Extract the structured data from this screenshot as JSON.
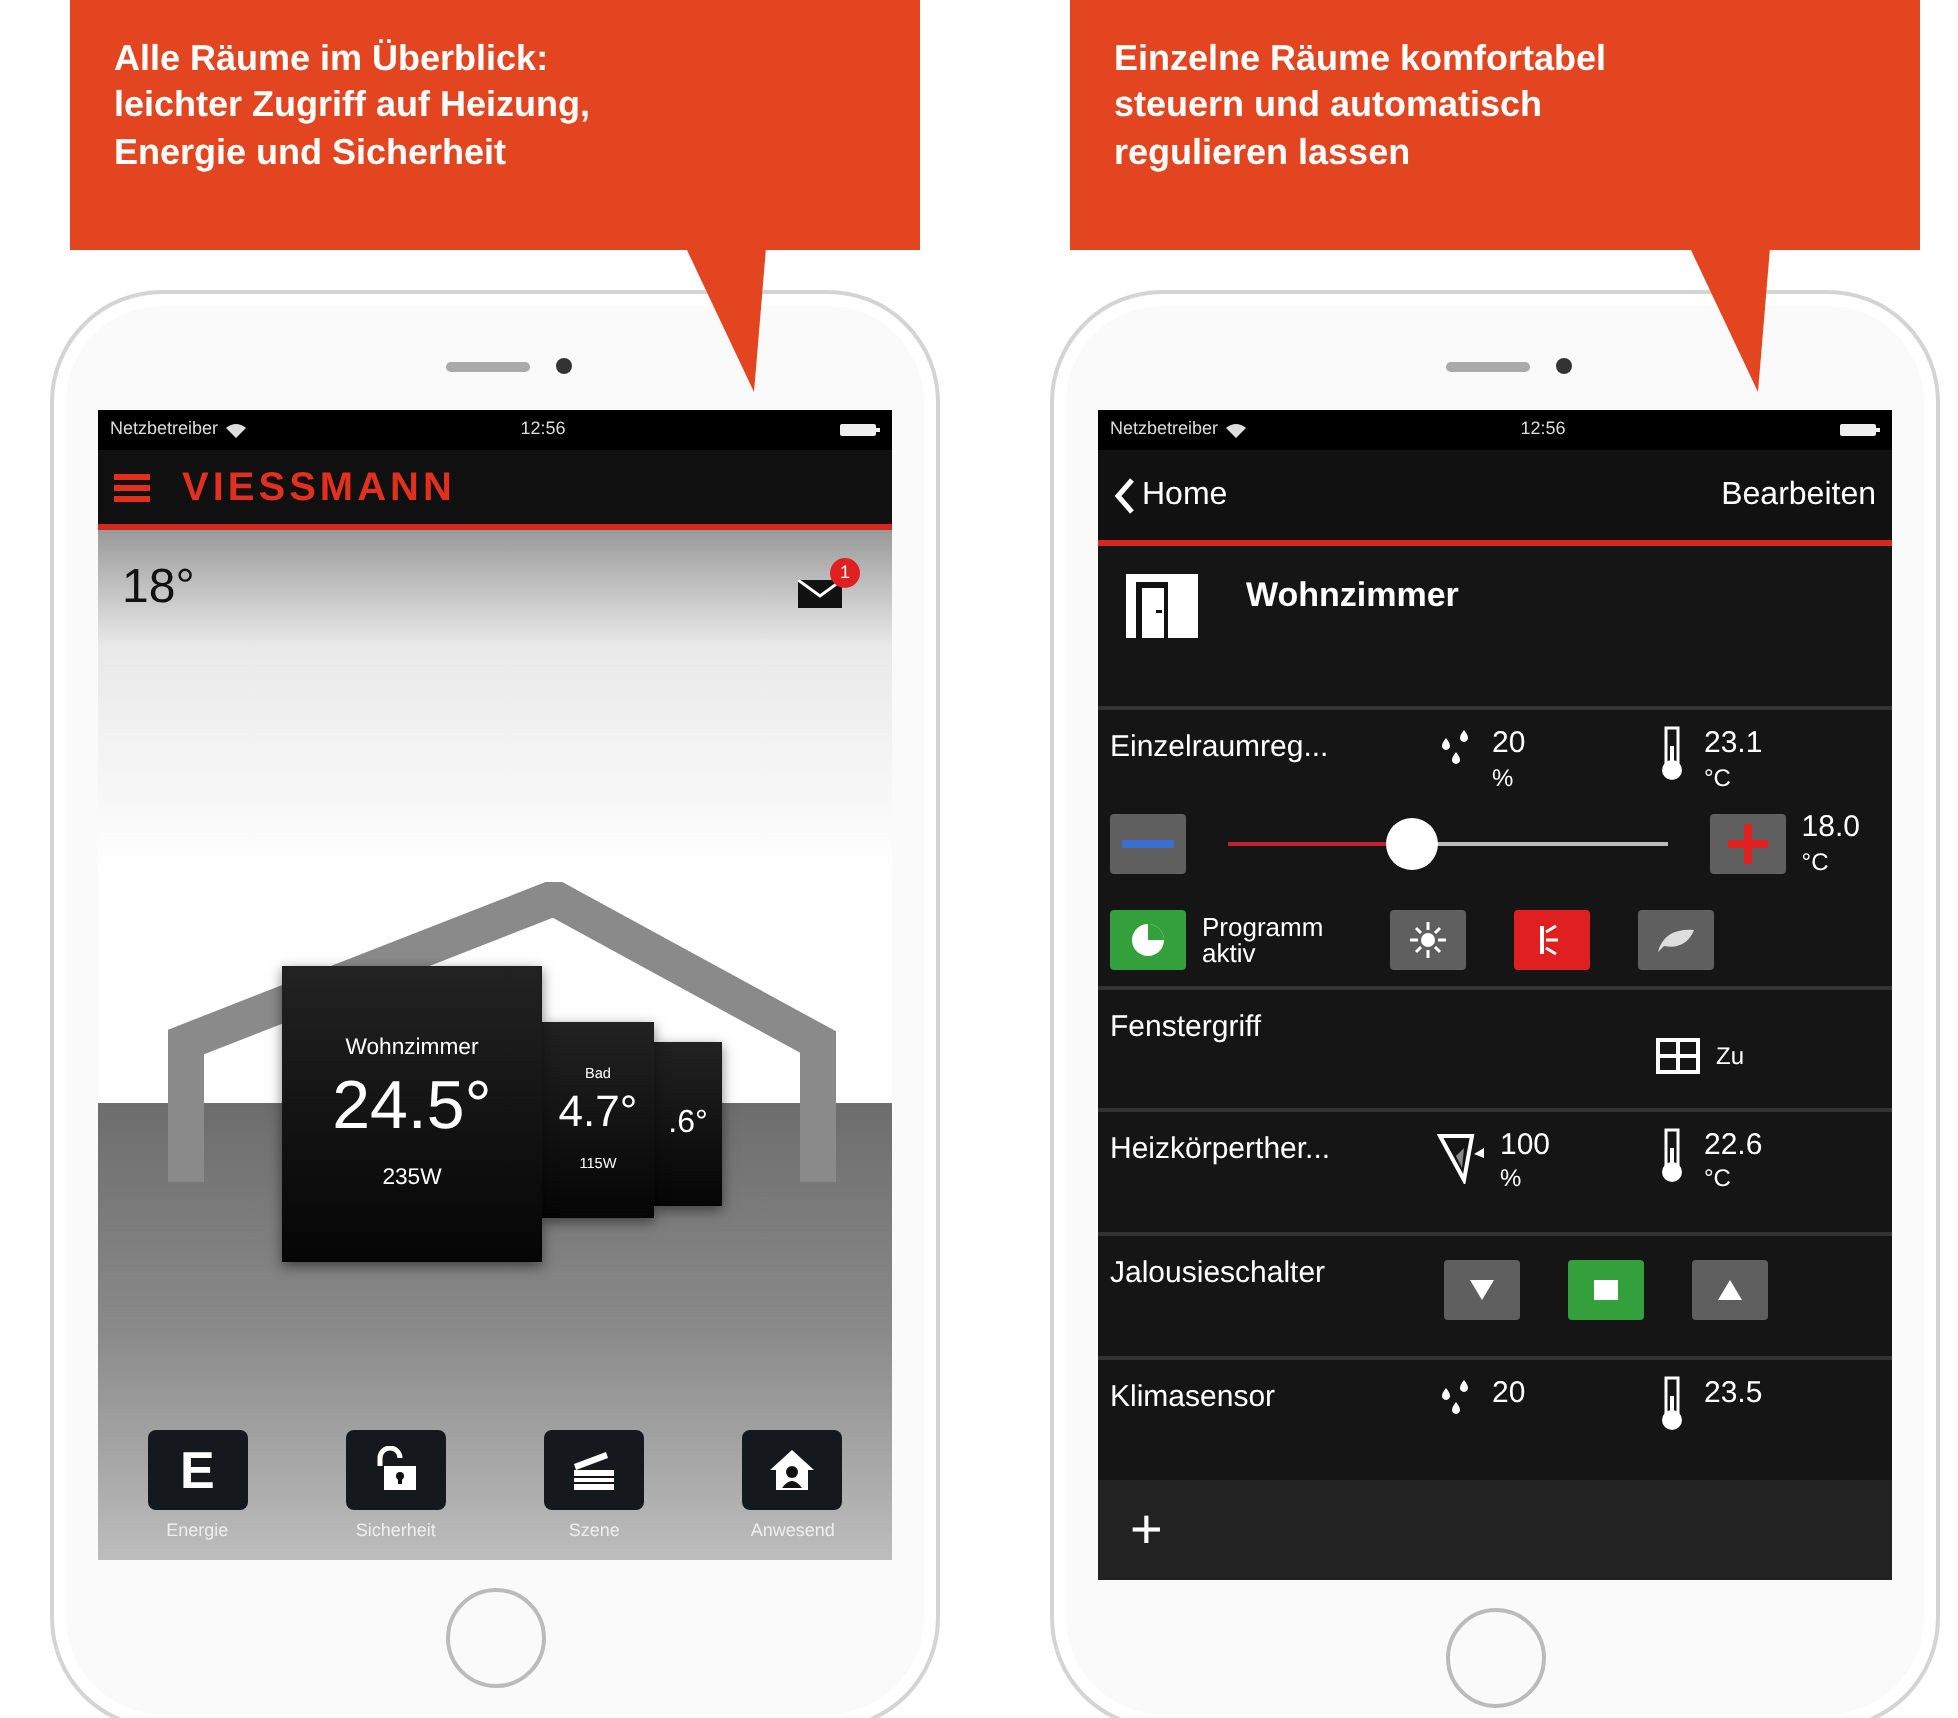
{
  "phones": [
    {
      "kind": "home",
      "caption": "Alle Räume im Überblick:\nleichter Zugriff auf Heizung,\nEnergie und Sicherheit",
      "status_bar": {
        "carrier": "Netzbetreiber",
        "time": "12:56"
      },
      "logo": "VIESSMANN",
      "outdoor_temperature": "18°",
      "message_badge": "1",
      "rooms": [
        {
          "name": "Wohnzimmer",
          "temperature": "24.5°",
          "power": "235W"
        },
        {
          "name": "Bad",
          "temperature": "4.7°",
          "power": "115W"
        },
        {
          "temperature": ".6°"
        }
      ],
      "tiles": [
        {
          "kind": "letter",
          "glyph": "E",
          "label": "Energie"
        },
        {
          "kind": "lock",
          "label": "Sicherheit"
        },
        {
          "kind": "clapper",
          "label": "Szene"
        },
        {
          "kind": "home",
          "label": "Anwesend"
        }
      ]
    },
    {
      "kind": "room",
      "caption": "Einzelne Räume komfortabel\nsteuern und automatisch\nregulieren lassen",
      "status_bar": {
        "carrier": "Netzbetreiber",
        "time": "12:56"
      },
      "nav": {
        "back": "Home",
        "action": "Bearbeiten"
      },
      "room": "Wohnzimmer",
      "devices": [
        {
          "kind": "thermostat",
          "name": "Einzelraumreg...",
          "humidity": {
            "value": "20",
            "unit": "%"
          },
          "temperature": {
            "value": "23.1",
            "unit": "°C"
          },
          "setpoint": {
            "level": 0.42,
            "value": "18.0",
            "unit": "°C"
          },
          "program": {
            "label": "Programm aktiv",
            "on": true
          },
          "modes": [
            {
              "kind": "sun",
              "selected": false
            },
            {
              "kind": "burst",
              "selected": true
            },
            {
              "kind": "leaf",
              "selected": false
            }
          ]
        },
        {
          "kind": "window",
          "name": "Fenstergriff",
          "state": "Zu"
        },
        {
          "kind": "radiator",
          "name": "Heizkörperther...",
          "valve": {
            "value": "100",
            "unit": "%"
          },
          "temperature": {
            "value": "22.6",
            "unit": "°C"
          }
        },
        {
          "kind": "blind",
          "name": "Jalousieschalter",
          "buttons": [
            {
              "kind": "down",
              "selected": false
            },
            {
              "kind": "stop",
              "selected": true
            },
            {
              "kind": "up",
              "selected": false
            }
          ]
        },
        {
          "kind": "sensor",
          "name": "Klimasensor",
          "humidity": {
            "value": "20"
          },
          "temperature": {
            "value": "23.5"
          }
        }
      ],
      "add_button": "+"
    }
  ]
}
